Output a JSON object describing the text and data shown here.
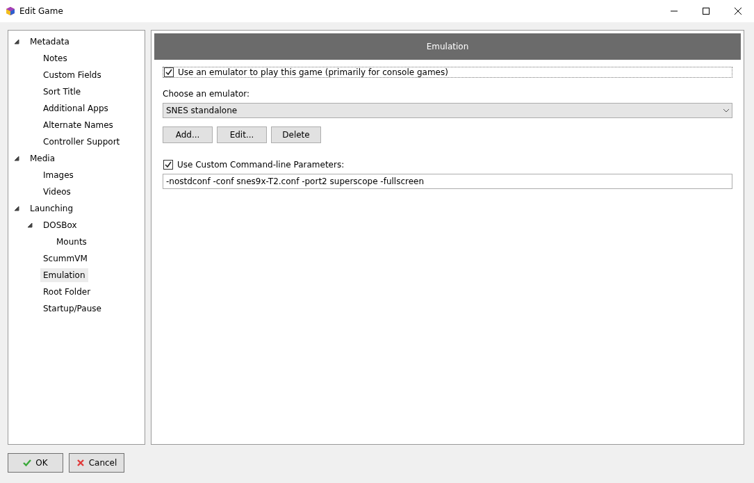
{
  "window": {
    "title": "Edit Game"
  },
  "tree": [
    {
      "label": "Metadata",
      "selected": false,
      "expanded": true,
      "children": [
        {
          "label": "Notes",
          "selected": false
        },
        {
          "label": "Custom Fields",
          "selected": false
        },
        {
          "label": "Sort Title",
          "selected": false
        },
        {
          "label": "Additional Apps",
          "selected": false
        },
        {
          "label": "Alternate Names",
          "selected": false
        },
        {
          "label": "Controller Support",
          "selected": false
        }
      ]
    },
    {
      "label": "Media",
      "selected": false,
      "expanded": true,
      "children": [
        {
          "label": "Images",
          "selected": false
        },
        {
          "label": "Videos",
          "selected": false
        }
      ]
    },
    {
      "label": "Launching",
      "selected": false,
      "expanded": true,
      "children": [
        {
          "label": "DOSBox",
          "selected": false,
          "expanded": true,
          "children": [
            {
              "label": "Mounts",
              "selected": false
            }
          ]
        },
        {
          "label": "ScummVM",
          "selected": false
        },
        {
          "label": "Emulation",
          "selected": true
        },
        {
          "label": "Root Folder",
          "selected": false
        },
        {
          "label": "Startup/Pause",
          "selected": false
        }
      ]
    }
  ],
  "panel": {
    "header": "Emulation",
    "use_emulator": {
      "label": "Use an emulator to play this game (primarily for console games)",
      "checked": true
    },
    "emulator_label": "Choose an emulator:",
    "emulator": {
      "value": "SNES standalone"
    },
    "buttons": [
      "Add...",
      "Edit...",
      "Delete"
    ],
    "custom_params": {
      "label": "Use Custom Command-line Parameters:",
      "checked": true
    },
    "params": {
      "value": "-nostdconf -conf snes9x-T2.conf -port2 superscope -fullscreen"
    }
  },
  "footer": [
    {
      "label": "OK",
      "kind": "ok"
    },
    {
      "label": "Cancel",
      "kind": "cancel"
    }
  ]
}
